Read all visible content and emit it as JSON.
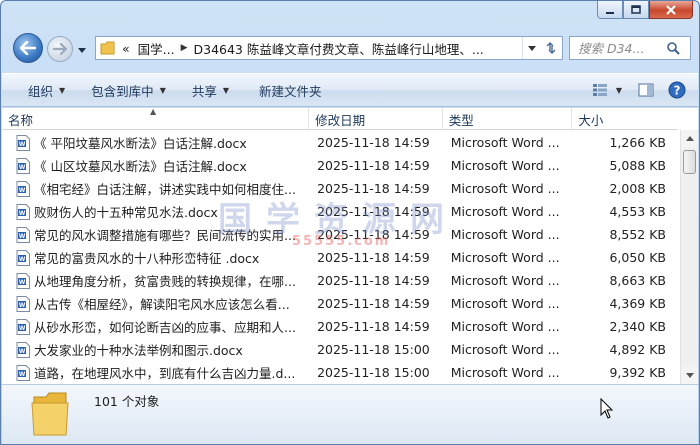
{
  "window": {
    "caption": {
      "minimize_icon": "minimize-icon",
      "maximize_icon": "maximize-icon",
      "close_icon": "close-icon"
    }
  },
  "address": {
    "overflow": "«",
    "crumbs": [
      "国学...",
      "D34643 陈益峰文章付费文章、陈益峰行山地理、..."
    ],
    "search_placeholder": "搜索 D34..."
  },
  "toolbar": {
    "organize": "组织",
    "include_library": "包含到库中",
    "share": "共享",
    "new_folder": "新建文件夹"
  },
  "columns": {
    "name": "名称",
    "date": "修改日期",
    "type": "类型",
    "size": "大小"
  },
  "files": [
    {
      "name": "《 平阳坟墓风水断法》白话注解.docx",
      "date": "2025-11-18 14:59",
      "type": "Microsoft Word ...",
      "size": "1,266 KB"
    },
    {
      "name": "《 山区坟墓风水断法》白话注解.docx",
      "date": "2025-11-18 14:59",
      "type": "Microsoft Word ...",
      "size": "5,088 KB"
    },
    {
      "name": "《相宅经》白话注解，讲述实践中如何相度住...",
      "date": "2025-11-18 14:59",
      "type": "Microsoft Word ...",
      "size": "2,008 KB"
    },
    {
      "name": "败财伤人的十五种常见水法.docx",
      "date": "2025-11-18 14:59",
      "type": "Microsoft Word ...",
      "size": "4,553 KB"
    },
    {
      "name": "常见的风水调整措施有哪些？民间流传的实用...",
      "date": "2025-11-18 14:59",
      "type": "Microsoft Word ...",
      "size": "8,552 KB"
    },
    {
      "name": "常见的富贵风水的十八种形峦特征 .docx",
      "date": "2025-11-18 14:59",
      "type": "Microsoft Word ...",
      "size": "6,050 KB"
    },
    {
      "name": "从地理角度分析，贫富贵贱的转换规律，在哪...",
      "date": "2025-11-18 14:59",
      "type": "Microsoft Word ...",
      "size": "8,663 KB"
    },
    {
      "name": "从古传《相屋经》，解读阳宅风水应该怎么看...",
      "date": "2025-11-18 14:59",
      "type": "Microsoft Word ...",
      "size": "4,369 KB"
    },
    {
      "name": "从砂水形峦，如何论断吉凶的应事、应期和人...",
      "date": "2025-11-18 14:59",
      "type": "Microsoft Word ...",
      "size": "2,340 KB"
    },
    {
      "name": "大发家业的十种水法举例和图示.docx",
      "date": "2025-11-18 15:00",
      "type": "Microsoft Word ...",
      "size": "4,892 KB"
    },
    {
      "name": "道路，在地理风水中，到底有什么吉凶力量.d...",
      "date": "2025-11-18 15:00",
      "type": "Microsoft Word ...",
      "size": "9,392 KB"
    }
  ],
  "status": {
    "count": "101 个对象"
  },
  "watermark": {
    "text": "国学资源网",
    "sub": "55555.com"
  },
  "colors": {
    "titlebar": "#cfe3f7",
    "toolbar_text": "#1e395b",
    "close_button": "#c8472c"
  }
}
